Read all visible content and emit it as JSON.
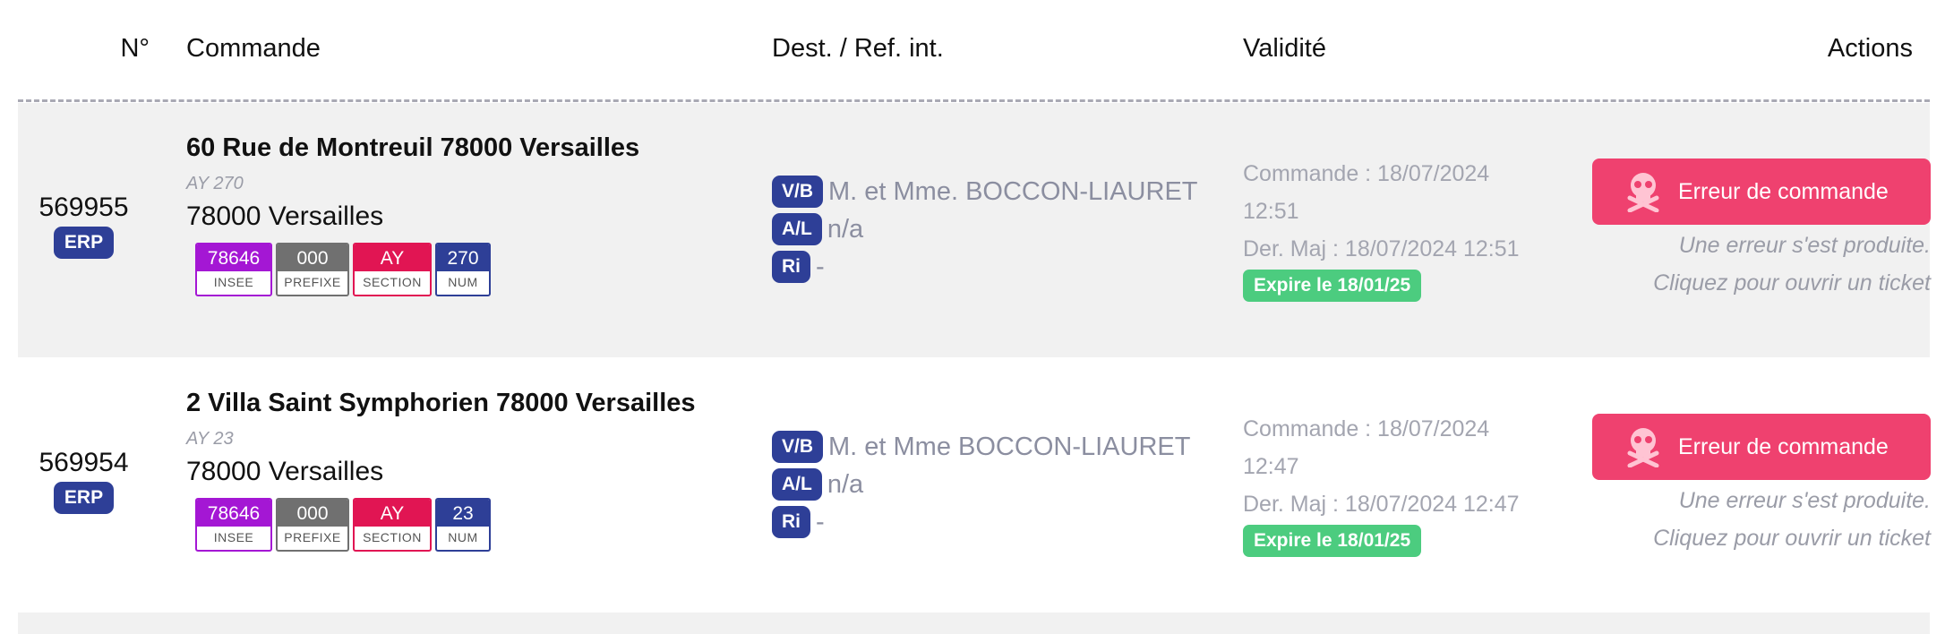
{
  "header": {
    "num": "N°",
    "commande": "Commande",
    "dest": "Dest. / Ref. int.",
    "validite": "Validité",
    "actions": "Actions"
  },
  "rows": [
    {
      "num": "569955",
      "erp": "ERP",
      "address": "60 Rue de Montreuil 78000 Versailles",
      "ref": "AY 270",
      "city": "78000 Versailles",
      "cadastre": {
        "insee": "78646",
        "insee_label": "INSEE",
        "prefixe": "000",
        "prefixe_label": "PREFIXE",
        "section": "AY",
        "section_label": "SECTION",
        "num": "270",
        "num_label": "NUM"
      },
      "vb_label": "V/B",
      "vb_value": "M. et Mme. BOCCON-LIAURET",
      "al_label": "A/L",
      "al_value": "n/a",
      "ri_label": "Ri",
      "ri_value": "-",
      "commande_date_1": "Commande : 18/07/2024",
      "commande_date_2": "12:51",
      "maj": "Der. Maj : 18/07/2024 12:51",
      "expire": "Expire le 18/01/25",
      "error_button": "Erreur de commande",
      "error_note_1": "Une erreur s'est produite.",
      "error_note_2": "Cliquez pour ouvrir un ticket"
    },
    {
      "num": "569954",
      "erp": "ERP",
      "address": "2 Villa Saint Symphorien 78000 Versailles",
      "ref": "AY 23",
      "city": "78000 Versailles",
      "cadastre": {
        "insee": "78646",
        "insee_label": "INSEE",
        "prefixe": "000",
        "prefixe_label": "PREFIXE",
        "section": "AY",
        "section_label": "SECTION",
        "num": "23",
        "num_label": "NUM"
      },
      "vb_label": "V/B",
      "vb_value": "M. et Mme BOCCON-LIAURET",
      "al_label": "A/L",
      "al_value": "n/a",
      "ri_label": "Ri",
      "ri_value": "-",
      "commande_date_1": "Commande : 18/07/2024",
      "commande_date_2": "12:47",
      "maj": "Der. Maj : 18/07/2024 12:47",
      "expire": "Expire le 18/01/25",
      "error_button": "Erreur de commande",
      "error_note_1": "Une erreur s'est produite.",
      "error_note_2": "Cliquez pour ouvrir un ticket"
    }
  ],
  "colors": {
    "erp": "#2e3f97",
    "insee": "#a417d4",
    "prefixe": "#707070",
    "section": "#e11553",
    "num": "#2e3f97",
    "expire": "#4ccc7f",
    "error": "#ef416f"
  },
  "icons": {
    "error": "skull-crossbones-icon"
  }
}
